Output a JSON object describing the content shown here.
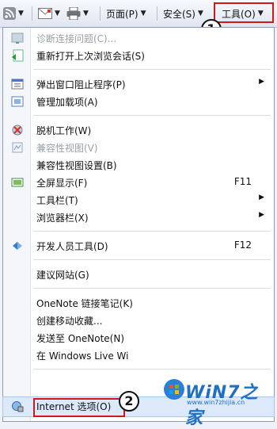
{
  "toolbar": {
    "page_label": "页面(P)",
    "safety_label": "安全(S)",
    "tools_label": "工具(O)",
    "dropdown_icon": "triangle-down"
  },
  "callouts": {
    "one": "1",
    "two": "2"
  },
  "menu": {
    "items": [
      {
        "label": "诊断连接问题(C)...",
        "icon": "diagnose-icon",
        "enabled": false
      },
      {
        "label": "重新打开上次浏览会话(S)",
        "icon": "reopen-session-icon",
        "enabled": true
      },
      {
        "label": "弹出窗口阻止程序(P)",
        "icon": "popup-blocker-icon",
        "enabled": true,
        "submenu": true
      },
      {
        "label": "管理加载项(A)",
        "icon": "addons-icon",
        "enabled": true
      },
      {
        "label": "脱机工作(W)",
        "icon": "offline-icon",
        "enabled": true
      },
      {
        "label": "兼容性视图(V)",
        "icon": "compat-view-icon",
        "enabled": false
      },
      {
        "label": "兼容性视图设置(B)",
        "enabled": true
      },
      {
        "label": "全屏显示(F)",
        "icon": "fullscreen-icon",
        "enabled": true,
        "shortcut": "F11"
      },
      {
        "label": "工具栏(T)",
        "enabled": true,
        "submenu": true
      },
      {
        "label": "浏览器栏(X)",
        "enabled": true,
        "submenu": true
      },
      {
        "label": "开发人员工具(D)",
        "icon": "dev-tools-icon",
        "enabled": true,
        "shortcut": "F12"
      },
      {
        "label": "建议网站(G)",
        "enabled": true
      },
      {
        "label": "OneNote 链接笔记(K)",
        "enabled": true
      },
      {
        "label": "创建移动收藏...",
        "enabled": true
      },
      {
        "label": "发送至 OneNote(N)",
        "enabled": true
      },
      {
        "label": "在 Windows Live Wi",
        "enabled": true
      },
      {
        "label": "Internet 选项(O)",
        "icon": "internet-options-icon",
        "enabled": true,
        "highlighted": true
      }
    ]
  },
  "watermark": {
    "brand": "WiN7之家",
    "url": "www.win7zhijia.cn"
  }
}
